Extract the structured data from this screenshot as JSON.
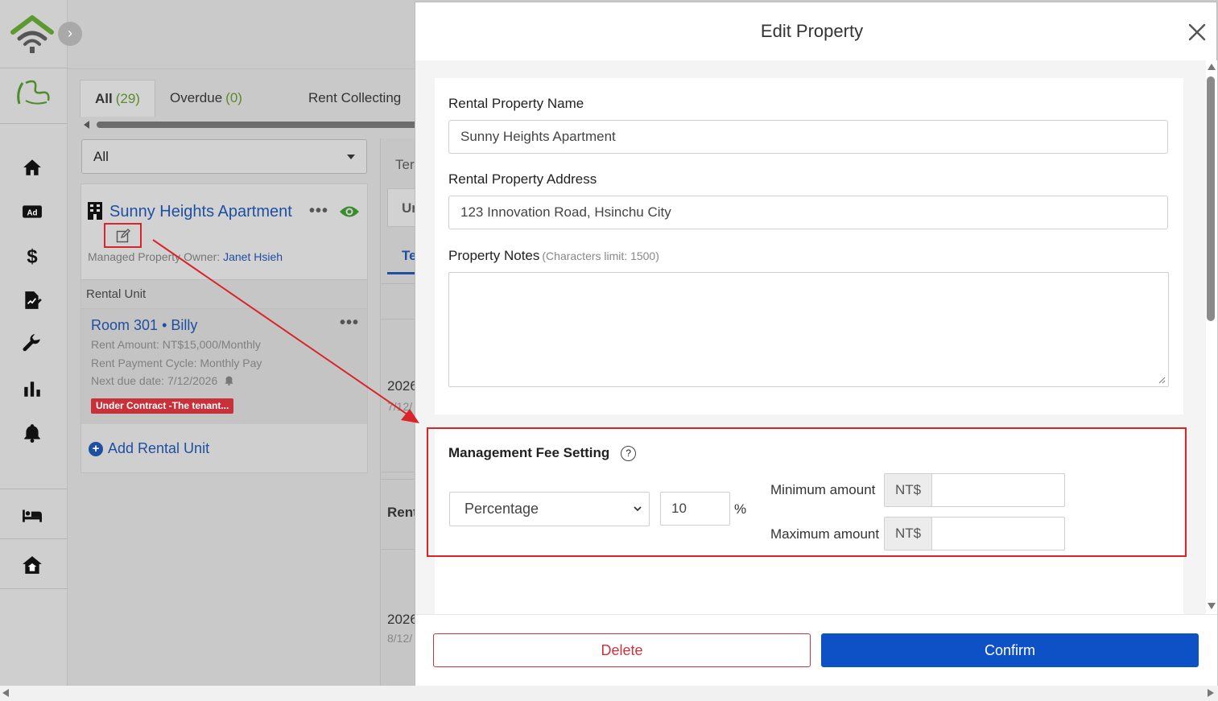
{
  "colors": {
    "accent_blue": "#0e51c7",
    "link_blue": "#1f4fa0",
    "danger_red": "#c9343c",
    "highlight_red": "#d9252a",
    "count_green": "#5a8c2a"
  },
  "sidebar": {
    "icons": [
      "home-icon",
      "ad-icon",
      "dollar-icon",
      "contract-icon",
      "wrench-icon",
      "bar-chart-icon",
      "bell-icon",
      "bed-icon",
      "house-icon"
    ]
  },
  "tabs": [
    {
      "label": "All",
      "count": "(29)"
    },
    {
      "label": "Overdue",
      "count": "(0)"
    },
    {
      "label": "Rent Collecting",
      "count": ""
    }
  ],
  "filter": {
    "value": "All"
  },
  "property_card": {
    "name": "Sunny Heights Apartment",
    "owner_label": "Managed Property Owner:",
    "owner_name": "Janet Hsieh",
    "unit_section": "Rental Unit",
    "unit": {
      "room": "Room 301",
      "sep": "•",
      "tenant": "Billy",
      "rent_amount": "Rent Amount: NT$15,000/Monthly",
      "payment_cycle": "Rent Payment Cycle: Monthly Pay",
      "next_due": "Next due date:  7/12/2026",
      "badge": "Under Contract -The tenant..."
    },
    "add_unit": "Add Rental Unit"
  },
  "middle_column": {
    "t1": "Ter",
    "t2": "Ur",
    "t3": "Te",
    "d1": "2026",
    "d1b": "7/12/",
    "rent": "Rent",
    "d2": "2026",
    "d2b": "8/12/"
  },
  "modal": {
    "title": "Edit Property",
    "name_label": "Rental Property Name",
    "name_value": "Sunny Heights Apartment",
    "address_label": "Rental Property Address",
    "address_value": "123 Innovation Road, Hsinchu City",
    "notes_label": "Property Notes",
    "notes_hint": "(Characters limit: 1500)",
    "fee": {
      "title": "Management Fee Setting",
      "help": "?",
      "type": "Percentage",
      "percent_value": "10",
      "percent_sign": "%",
      "min_label": "Minimum amount",
      "max_label": "Maximum amount",
      "currency": "NT$"
    },
    "delete_label": "Delete",
    "confirm_label": "Confirm"
  }
}
